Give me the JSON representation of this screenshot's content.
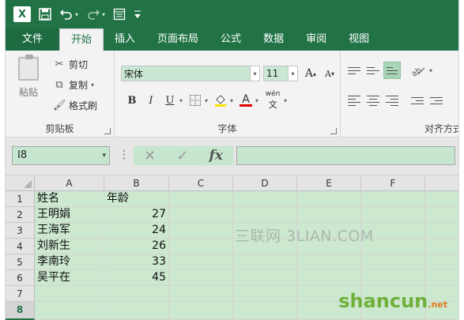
{
  "app": {
    "name": "Excel"
  },
  "qat": {
    "logo": "X",
    "icons": [
      "excel-logo-icon",
      "save-icon",
      "undo-icon",
      "redo-icon",
      "form-icon",
      "customize-icon"
    ]
  },
  "tabs": [
    {
      "label": "文件",
      "active": false
    },
    {
      "label": "开始",
      "active": true
    },
    {
      "label": "插入",
      "active": false
    },
    {
      "label": "页面布局",
      "active": false
    },
    {
      "label": "公式",
      "active": false
    },
    {
      "label": "数据",
      "active": false
    },
    {
      "label": "审阅",
      "active": false
    },
    {
      "label": "视图",
      "active": false
    }
  ],
  "ribbon": {
    "clipboard": {
      "group_label": "剪贴板",
      "paste": "粘贴",
      "cut": "剪切",
      "copy": "复制",
      "format_painter": "格式刷"
    },
    "font": {
      "group_label": "字体",
      "font_name": "宋体",
      "font_size": "11",
      "grow": "A",
      "shrink": "A",
      "bold": "B",
      "italic": "I",
      "underline": "U",
      "font_color_letter": "A",
      "phonetic": "wén"
    },
    "alignment": {
      "group_label": "对齐方式"
    }
  },
  "formula_bar": {
    "name_box": "I8",
    "fx": "fx",
    "value": ""
  },
  "sheet": {
    "columns": [
      "A",
      "B",
      "C",
      "D",
      "E",
      "F"
    ],
    "rows": [
      "1",
      "2",
      "3",
      "4",
      "5",
      "6",
      "7",
      "8"
    ],
    "selected_row": "8",
    "cells": {
      "A1": "姓名",
      "B1": "年龄",
      "A2": "王明娟",
      "B2": "27",
      "A3": "王海军",
      "B3": "24",
      "A4": "刘新生",
      "B4": "26",
      "A5": "李南玲",
      "B5": "33",
      "A6": "吴平在",
      "B6": "45"
    }
  },
  "watermarks": {
    "center": "三联网 3LIAN.COM",
    "logo": "shancun",
    "logo_suffix": ".net"
  },
  "colors": {
    "accent": "#217346",
    "cell_fill": "#cce8cf"
  }
}
